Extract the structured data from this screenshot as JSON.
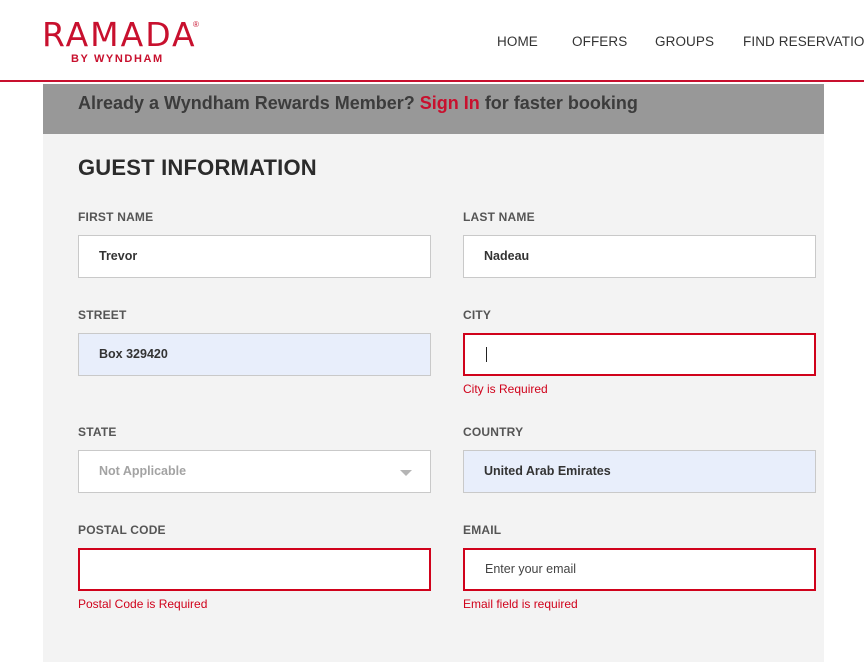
{
  "header": {
    "logo": {
      "brand": "RAMADA",
      "registered": "®",
      "sub": "BY WYNDHAM"
    },
    "nav": [
      "HOME",
      "OFFERS",
      "GROUPS",
      "FIND RESERVATION"
    ]
  },
  "banner": {
    "prefix": "Already a Wyndham Rewards Member?",
    "link": "Sign In",
    "suffix": "for faster booking"
  },
  "form": {
    "title": "GUEST INFORMATION",
    "first_name": {
      "label": "FIRST NAME",
      "value": "Trevor"
    },
    "last_name": {
      "label": "LAST NAME",
      "value": "Nadeau"
    },
    "street": {
      "label": "STREET",
      "value": "Box 329420"
    },
    "city": {
      "label": "CITY",
      "value": "",
      "error": "City is Required"
    },
    "state": {
      "label": "STATE",
      "value": "Not Applicable"
    },
    "country": {
      "label": "COUNTRY",
      "value": "United Arab Emirates"
    },
    "postal_code": {
      "label": "POSTAL CODE",
      "value": "",
      "error": "Postal Code is Required"
    },
    "email": {
      "label": "EMAIL",
      "placeholder": "Enter your email",
      "error": "Email field is required"
    }
  },
  "colors": {
    "brand": "#c8102e",
    "error": "#d0021b",
    "autofill": "#e8eefb",
    "banner": "#989898"
  }
}
